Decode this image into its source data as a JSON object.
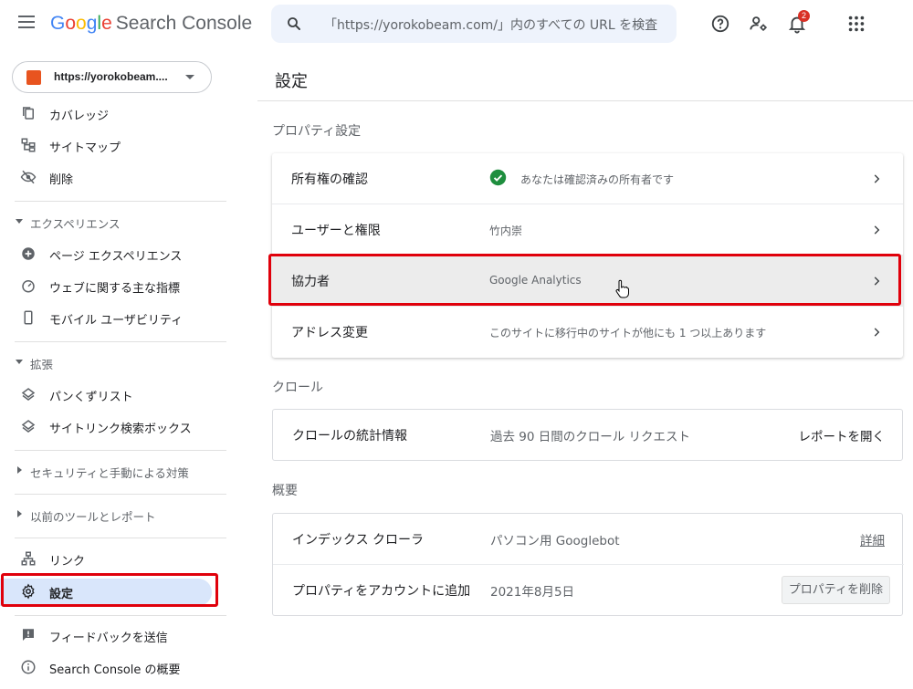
{
  "header": {
    "logo_google": [
      "G",
      "o",
      "o",
      "g",
      "l",
      "e"
    ],
    "logo_product": "Search Console",
    "search_placeholder": "「https://yorokobeam.com/」内のすべての URL を検査",
    "notification_count": "2"
  },
  "sidebar": {
    "property_label": "https://yorokobeam....",
    "items_top": [
      {
        "label": "カバレッジ",
        "icon": "pages-icon"
      },
      {
        "label": "サイトマップ",
        "icon": "sitemap-icon"
      },
      {
        "label": "削除",
        "icon": "visibility-off-icon"
      }
    ],
    "section_experience": "エクスペリエンス",
    "items_experience": [
      {
        "label": "ページ エクスペリエンス",
        "icon": "add-circle-icon"
      },
      {
        "label": "ウェブに関する主な指標",
        "icon": "speed-icon"
      },
      {
        "label": "モバイル ユーザビリティ",
        "icon": "smartphone-icon"
      }
    ],
    "section_enhancements": "拡張",
    "items_enhancements": [
      {
        "label": "パンくずリスト",
        "icon": "layers-icon"
      },
      {
        "label": "サイトリンク検索ボックス",
        "icon": "layers-icon"
      }
    ],
    "section_security": "セキュリティと手動による対策",
    "section_legacy": "以前のツールとレポート",
    "item_links": "リンク",
    "item_settings": "設定",
    "item_feedback": "フィードバックを送信",
    "item_about": "Search Console の概要"
  },
  "main": {
    "title": "設定",
    "property_settings": {
      "heading": "プロパティ設定",
      "rows": [
        {
          "key": "所有権の確認",
          "value": "あなたは確認済みの所有者です"
        },
        {
          "key": "ユーザーと権限",
          "value": "竹内崇"
        },
        {
          "key": "協力者",
          "value": "Google Analytics"
        },
        {
          "key": "アドレス変更",
          "value": "このサイトに移行中のサイトが他にも 1 つ以上あります"
        }
      ]
    },
    "crawl": {
      "heading": "クロール",
      "key": "クロールの統計情報",
      "value": "過去 90 日間のクロール リクエスト",
      "action": "レポートを開く"
    },
    "overview": {
      "heading": "概要",
      "rows": [
        {
          "key": "インデックス クローラ",
          "value": "パソコン用 Googlebot",
          "action": "詳細"
        },
        {
          "key": "プロパティをアカウントに追加",
          "value": "2021年8月5日",
          "action": "プロパティを削除"
        }
      ]
    }
  },
  "colors": {
    "highlight_box": "#e0000b",
    "active_nav": "#d9e6fb",
    "check_green": "#1e8e3e"
  }
}
